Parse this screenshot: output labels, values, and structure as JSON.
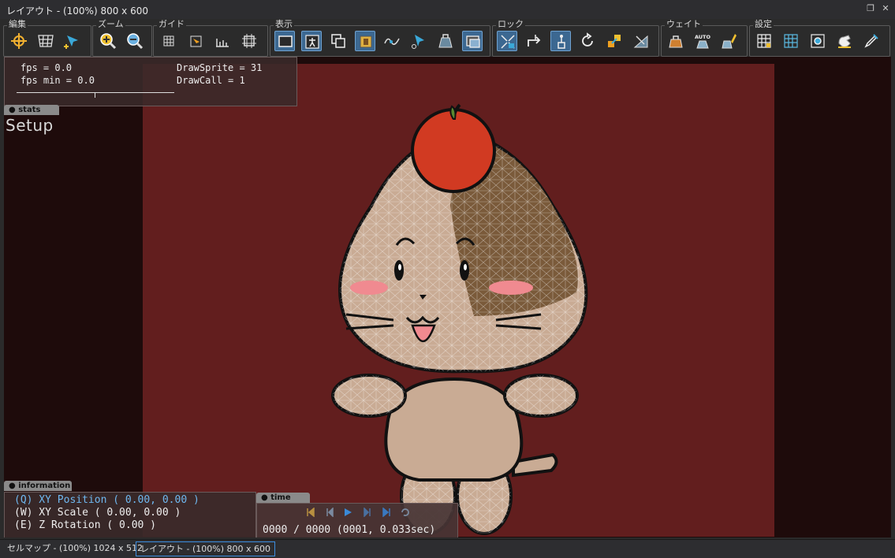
{
  "window": {
    "title": "レイアウト - (100%) 800 x 600"
  },
  "toolbar": {
    "groups": [
      {
        "label": "編集",
        "buttons": [
          "move-icon",
          "mesh-icon",
          "bone-add-icon"
        ]
      },
      {
        "label": "ズーム",
        "buttons": [
          "zoom-in-icon",
          "zoom-out-icon"
        ]
      },
      {
        "label": "ガイド",
        "buttons": [
          "grid-icon",
          "anchor-icon",
          "ruler-icon",
          "frame-icon"
        ]
      },
      {
        "label": "表示",
        "buttons": [
          "canvas-frame-icon",
          "bone-view-icon",
          "overlap-icon",
          "image-icon",
          "curve-icon",
          "pin-icon",
          "weight-view-icon",
          "display-mode-icon"
        ]
      },
      {
        "label": "ロック",
        "buttons": [
          "lock-scale-icon",
          "lock-move-icon",
          "lock-bone-icon",
          "lock-rotate-icon",
          "lock-link-icon",
          "lock-mesh-icon"
        ]
      },
      {
        "label": "ウェイト",
        "buttons": [
          "weight-lock-icon",
          "weight-auto-icon",
          "weight-brush-icon"
        ]
      },
      {
        "label": "設定",
        "buttons": [
          "settings-grid-icon",
          "settings-mesh-icon",
          "settings-gear-icon",
          "settings-hand-icon",
          "settings-pen-icon"
        ]
      }
    ],
    "auto_label": "AUTO"
  },
  "stats": {
    "tab_label": "stats",
    "fps": "fps = 0.0",
    "fps_min": "fps min = 0.0",
    "draw_sprite": "DrawSprite = 31",
    "draw_call": "DrawCall = 1"
  },
  "scene": {
    "label": "Setup"
  },
  "information": {
    "tab_label": "information",
    "position": "(Q) XY Position ( 0.00, 0.00 )",
    "scale": "(W) XY Scale ( 0.00, 0.00 )",
    "rotation": "(E) Z Rotation ( 0.00 )"
  },
  "time": {
    "tab_label": "time",
    "readout": "0000 / 0000 (0001, 0.033sec)"
  },
  "statusbar": {
    "tabs": [
      {
        "label": "セルマップ - (100%) 1024 x 512",
        "active": false
      },
      {
        "label": "レイアウト - (100%) 800 x 600",
        "active": true
      }
    ]
  },
  "colors": {
    "canvas": "#621e1e",
    "viewport": "#1e0b0b",
    "accent": "#3d8ee0",
    "info_highlight": "#6fb8f0"
  }
}
